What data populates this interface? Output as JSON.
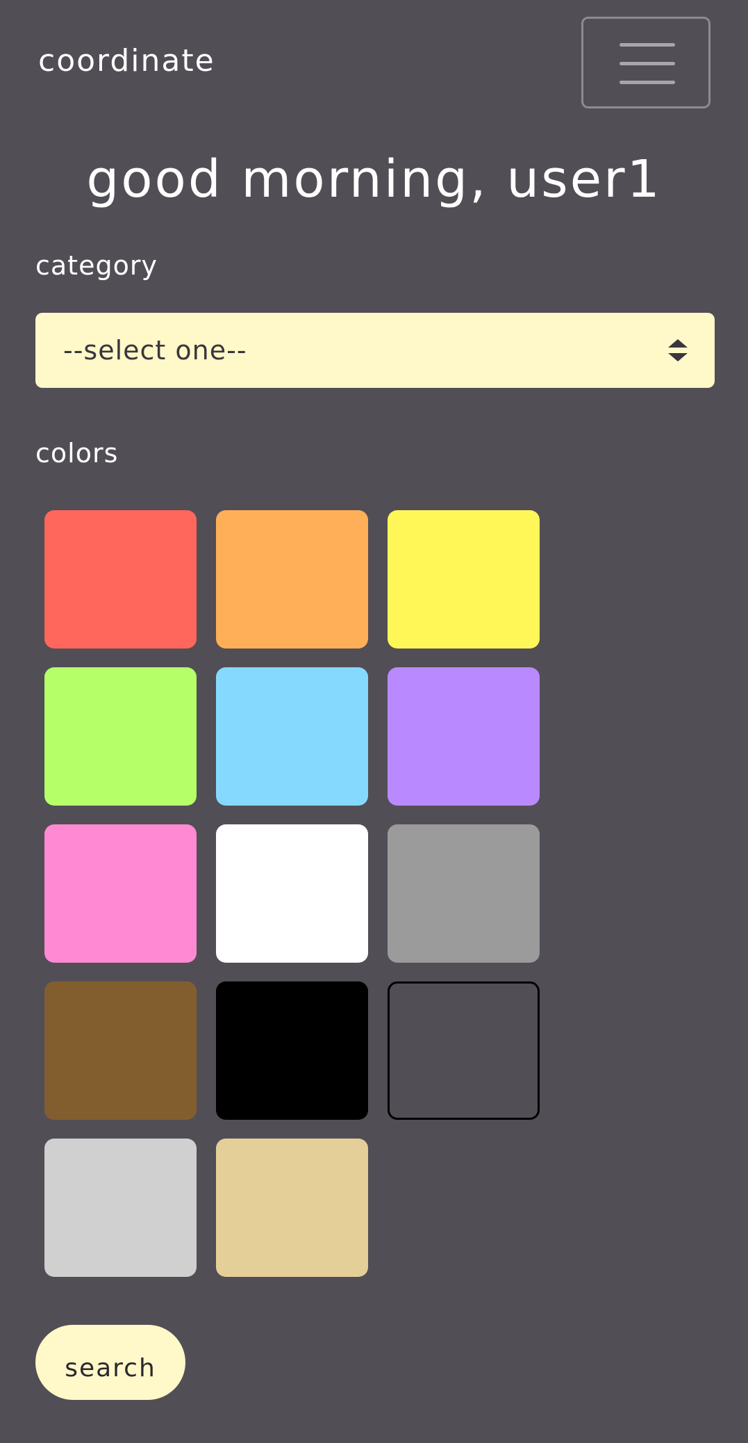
{
  "navbar": {
    "brand": "coordinate",
    "menu_icon": "hamburger-menu-icon"
  },
  "greeting": "good morning, user1",
  "category": {
    "label": "category",
    "selected": "--select one--",
    "icon": "select-arrows-icon"
  },
  "colors": {
    "label": "colors",
    "swatches": [
      {
        "name": "red",
        "hex": "#ff675c"
      },
      {
        "name": "orange",
        "hex": "#ffaf57"
      },
      {
        "name": "yellow",
        "hex": "#fff757"
      },
      {
        "name": "green",
        "hex": "#b5ff69"
      },
      {
        "name": "blue",
        "hex": "#85d9ff"
      },
      {
        "name": "purple",
        "hex": "#b98aff"
      },
      {
        "name": "pink",
        "hex": "#ff8ad3"
      },
      {
        "name": "white",
        "hex": "#ffffff"
      },
      {
        "name": "gray",
        "hex": "#9b9b9b"
      },
      {
        "name": "brown",
        "hex": "#825e2f"
      },
      {
        "name": "black",
        "hex": "#000000"
      },
      {
        "name": "clear",
        "hex": "#524e56",
        "outlined": true
      },
      {
        "name": "silver",
        "hex": "#d0d0d0"
      },
      {
        "name": "beige",
        "hex": "#e5cf98"
      }
    ]
  },
  "search_button": "search",
  "theme": {
    "background": "#524e56",
    "accent": "#fff8c9"
  }
}
